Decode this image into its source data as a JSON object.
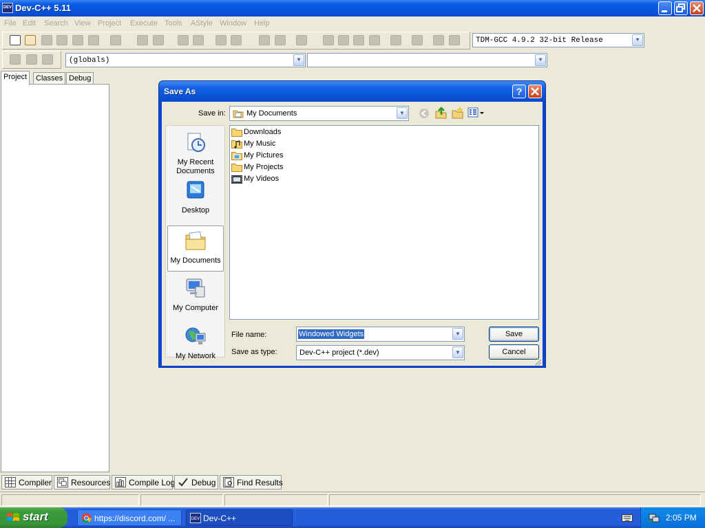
{
  "app": {
    "title": "Dev-C++ 5.11",
    "icon_text": "DEV"
  },
  "menu": [
    "File",
    "Edit",
    "Search",
    "View",
    "Project",
    "Execute",
    "Tools",
    "AStyle",
    "Window",
    "Help"
  ],
  "toolbar": {
    "compiler_select": "TDM-GCC 4.9.2 32-bit Release",
    "scope_select": "(globals)",
    "symbol_select": ""
  },
  "left_panel": {
    "tabs": [
      "Project",
      "Classes",
      "Debug"
    ]
  },
  "bottom_tabs": [
    "Compiler",
    "Resources",
    "Compile Log",
    "Debug",
    "Find Results"
  ],
  "dialog": {
    "title": "Save As",
    "save_in_label": "Save in:",
    "save_in_value": "My Documents",
    "places": [
      {
        "label_line1": "My Recent",
        "label_line2": "Documents",
        "icon": "recent-documents-icon"
      },
      {
        "label_line1": "Desktop",
        "label_line2": "",
        "icon": "desktop-icon"
      },
      {
        "label_line1": "My Documents",
        "label_line2": "",
        "icon": "my-documents-icon"
      },
      {
        "label_line1": "My Computer",
        "label_line2": "",
        "icon": "my-computer-icon"
      },
      {
        "label_line1": "My Network",
        "label_line2": "",
        "icon": "my-network-icon"
      }
    ],
    "files": [
      {
        "name": "Downloads",
        "icon": "folder-icon"
      },
      {
        "name": "My Music",
        "icon": "music-folder-icon"
      },
      {
        "name": "My Pictures",
        "icon": "pictures-folder-icon"
      },
      {
        "name": "My Projects",
        "icon": "folder-icon"
      },
      {
        "name": "My Videos",
        "icon": "videos-folder-icon"
      }
    ],
    "file_name_label": "File name:",
    "file_name_value": "Windowed Widgets",
    "save_type_label": "Save as type:",
    "save_type_value": "Dev-C++ project (*.dev)",
    "save_button": "Save",
    "cancel_button": "Cancel"
  },
  "taskbar": {
    "start_label": "start",
    "buttons": [
      {
        "label": "https://discord.com/ ...",
        "icon": "chrome-icon"
      },
      {
        "label": "Dev-C++",
        "icon": "devcpp-icon"
      }
    ],
    "clock": "2:05 PM"
  },
  "colors": {
    "title_blue": "#0a5ce3",
    "taskbar_blue": "#245edb",
    "start_green": "#3c9a3c",
    "face": "#ece9d8"
  }
}
